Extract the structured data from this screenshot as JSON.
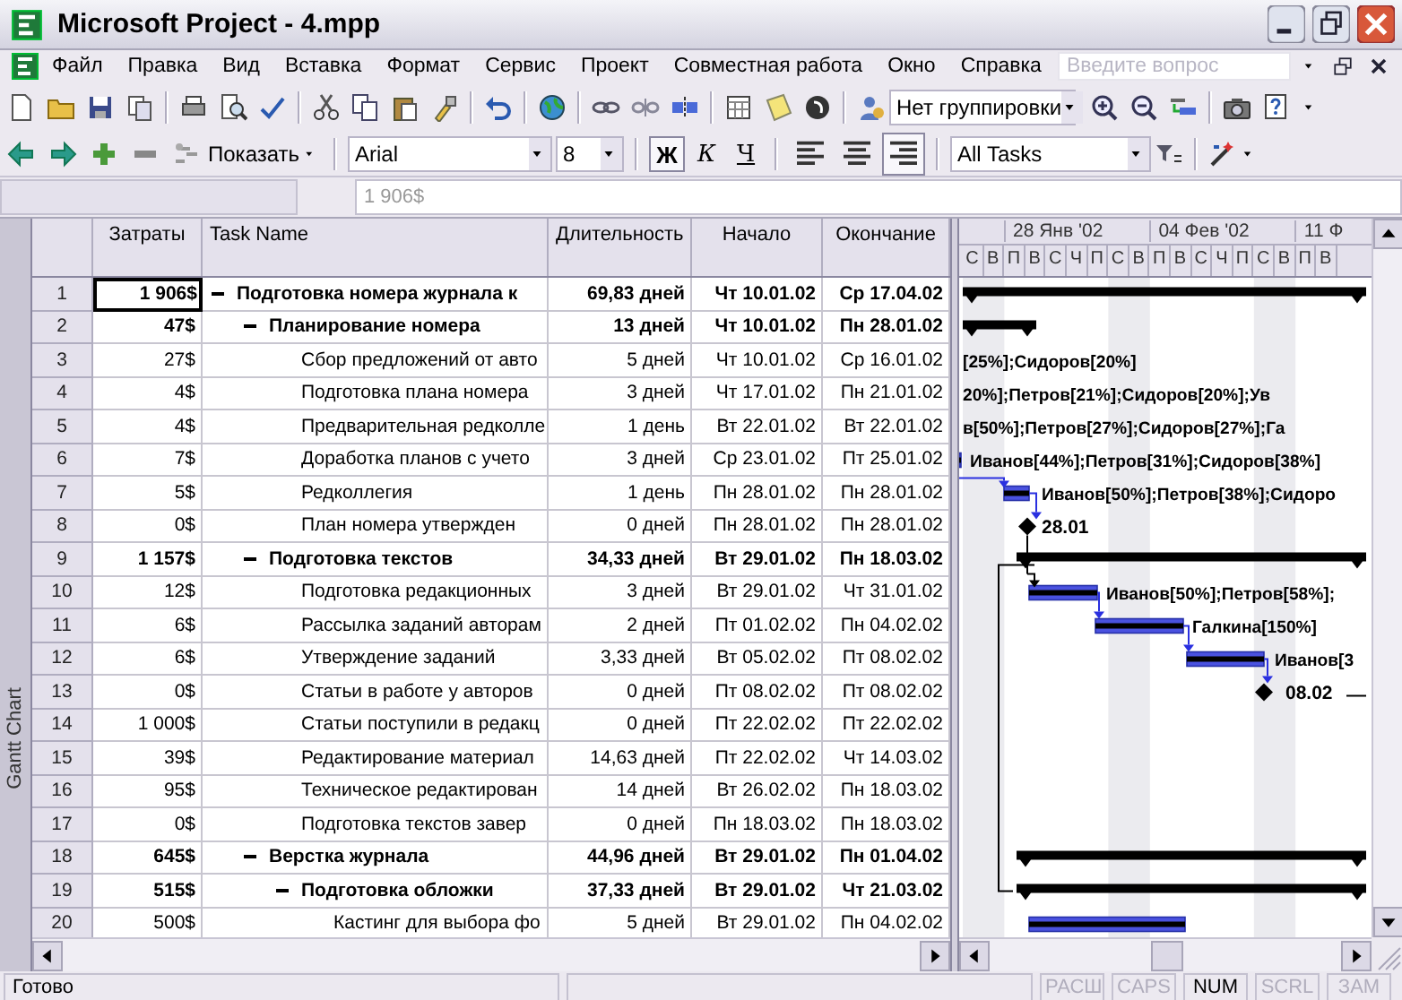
{
  "window": {
    "title": "Microsoft Project - 4.mpp"
  },
  "menu": {
    "items": [
      "Файл",
      "Правка",
      "Вид",
      "Вставка",
      "Формат",
      "Сервис",
      "Проект",
      "Совместная работа",
      "Окно",
      "Справка"
    ],
    "help_search": {
      "placeholder": "Введите вопрос"
    }
  },
  "standard_toolbar": {
    "grouping": "Нет группировки"
  },
  "formatting_toolbar": {
    "show_button": "Показать",
    "font": "Arial",
    "size": "8",
    "styles": [
      {
        "kind": "bold",
        "label": "Ж",
        "pressed": true
      },
      {
        "kind": "italic",
        "label": "К",
        "pressed": false
      },
      {
        "kind": "underline",
        "label": "Ч",
        "pressed": false
      }
    ],
    "alignment": [
      {
        "kind": "left",
        "pressed": false
      },
      {
        "kind": "center",
        "pressed": false
      },
      {
        "kind": "right",
        "pressed": true
      }
    ],
    "filter": "All Tasks"
  },
  "entry_bar": {
    "value": "1 906$"
  },
  "view_bar": {
    "label": "Gantt Chart"
  },
  "table": {
    "columns": [
      "Затраты",
      "Task Name",
      "Длительность",
      "Начало",
      "Окончание"
    ],
    "tasks": [
      {
        "id": "1",
        "cost": "1 906$",
        "name": "Подготовка номера журнала к",
        "duration": "69,83 дней",
        "start": "Чт 10.01.02",
        "finish": "Ср 17.04.02",
        "kind": "summary",
        "expanded": true,
        "selected": true,
        "children": [
          {
            "id": "2",
            "cost": "47$",
            "name": "Планирование номера",
            "duration": "13 дней",
            "start": "Чт 10.01.02",
            "finish": "Пн 28.01.02",
            "kind": "summary",
            "expanded": true,
            "selected": false,
            "children": [
              {
                "id": "3",
                "cost": "27$",
                "name": "Сбор предложений от авто",
                "duration": "5 дней",
                "start": "Чт 10.01.02",
                "finish": "Ср 16.01.02",
                "kind": "task",
                "selected": false,
                "bar_label": "[25%];Сидоров[20%]"
              },
              {
                "id": "4",
                "cost": "4$",
                "name": "Подготовка плана номера",
                "duration": "3 дней",
                "start": "Чт 17.01.02",
                "finish": "Пн 21.01.02",
                "kind": "task",
                "selected": false,
                "bar_label": "20%];Петров[21%];Сидоров[20%];Ув"
              },
              {
                "id": "5",
                "cost": "4$",
                "name": "Предварительная редколле",
                "duration": "1 день",
                "start": "Вт 22.01.02",
                "finish": "Вт 22.01.02",
                "kind": "task",
                "selected": false,
                "bar_label": "в[50%];Петров[27%];Сидоров[27%];Га"
              },
              {
                "id": "6",
                "cost": "7$",
                "name": "Доработка планов с учето",
                "duration": "3 дней",
                "start": "Ср 23.01.02",
                "finish": "Пт 25.01.02",
                "kind": "task",
                "selected": false,
                "bar_label": "Иванов[44%];Петров[31%];Сидоров[38%]"
              },
              {
                "id": "7",
                "cost": "5$",
                "name": "Редколлегия",
                "duration": "1 день",
                "start": "Пн 28.01.02",
                "finish": "Пн 28.01.02",
                "kind": "task",
                "selected": false,
                "bar_label": "Иванов[50%];Петров[38%];Сидоро"
              },
              {
                "id": "8",
                "cost": "0$",
                "name": "План номера утвержден",
                "duration": "0 дней",
                "start": "Пн 28.01.02",
                "finish": "Пн 28.01.02",
                "kind": "milestone",
                "selected": false,
                "bar_label": "28.01"
              }
            ]
          },
          {
            "id": "9",
            "cost": "1 157$",
            "name": "Подготовка текстов",
            "duration": "34,33 дней",
            "start": "Вт 29.01.02",
            "finish": "Пн 18.03.02",
            "kind": "summary",
            "expanded": true,
            "selected": false,
            "children": [
              {
                "id": "10",
                "cost": "12$",
                "name": "Подготовка редакционных",
                "duration": "3 дней",
                "start": "Вт 29.01.02",
                "finish": "Чт 31.01.02",
                "kind": "task",
                "selected": false,
                "bar_label": "Иванов[50%];Петров[58%];"
              },
              {
                "id": "11",
                "cost": "6$",
                "name": "Рассылка заданий авторам",
                "duration": "2 дней",
                "start": "Пт 01.02.02",
                "finish": "Пн 04.02.02",
                "kind": "task",
                "selected": false,
                "bar_label": "Галкина[150%]"
              },
              {
                "id": "12",
                "cost": "6$",
                "name": "Утверждение заданий",
                "duration": "3,33 дней",
                "start": "Вт 05.02.02",
                "finish": "Пт 08.02.02",
                "kind": "task",
                "selected": false,
                "bar_label": "Иванов[3"
              },
              {
                "id": "13",
                "cost": "0$",
                "name": "Статьи в работе у авторов",
                "duration": "0 дней",
                "start": "Пт 08.02.02",
                "finish": "Пт 08.02.02",
                "kind": "milestone",
                "selected": false,
                "bar_label": "08.02"
              },
              {
                "id": "14",
                "cost": "1 000$",
                "name": "Статьи поступили в редакц",
                "duration": "0 дней",
                "start": "Пт 22.02.02",
                "finish": "Пт 22.02.02",
                "kind": "milestone",
                "selected": false
              },
              {
                "id": "15",
                "cost": "39$",
                "name": "Редактирование материал",
                "duration": "14,63 дней",
                "start": "Пт 22.02.02",
                "finish": "Чт 14.03.02",
                "kind": "task",
                "selected": false
              },
              {
                "id": "16",
                "cost": "95$",
                "name": "Техническое редактирован",
                "duration": "14 дней",
                "start": "Вт 26.02.02",
                "finish": "Пн 18.03.02",
                "kind": "task",
                "selected": false
              },
              {
                "id": "17",
                "cost": "0$",
                "name": "Подготовка текстов завер",
                "duration": "0 дней",
                "start": "Пн 18.03.02",
                "finish": "Пн 18.03.02",
                "kind": "milestone",
                "selected": false
              }
            ]
          },
          {
            "id": "18",
            "cost": "645$",
            "name": "Верстка журнала",
            "duration": "44,96 дней",
            "start": "Вт 29.01.02",
            "finish": "Пн 01.04.02",
            "kind": "summary",
            "expanded": true,
            "selected": false,
            "children": [
              {
                "id": "19",
                "cost": "515$",
                "name": "Подготовка обложки",
                "duration": "37,33 дней",
                "start": "Вт 29.01.02",
                "finish": "Чт 21.03.02",
                "kind": "summary",
                "expanded": true,
                "selected": false,
                "children": [
                  {
                    "id": "20",
                    "cost": "500$",
                    "name": "Кастинг для выбора фо",
                    "duration": "5 дней",
                    "start": "Вт 29.01.02",
                    "finish": "Пн 04.02.02",
                    "kind": "task",
                    "selected": false
                  }
                ]
              }
            ]
          }
        ]
      }
    ]
  },
  "gantt": {
    "weeks": [
      "28 Янв '02",
      "04 Фев '02",
      "11 Ф"
    ],
    "days": [
      "С",
      "В",
      "П",
      "В",
      "С",
      "Ч",
      "П",
      "С",
      "В",
      "П",
      "В",
      "С",
      "Ч",
      "П",
      "С",
      "В",
      "П",
      "В"
    ]
  },
  "status_bar": {
    "text": "Готово",
    "indicators": [
      {
        "label": "РАСШ",
        "on": false
      },
      {
        "label": "CAPS",
        "on": false
      },
      {
        "label": "NUM",
        "on": true
      },
      {
        "label": "SCRL",
        "on": false
      },
      {
        "label": "ЗАМ",
        "on": false
      }
    ]
  }
}
